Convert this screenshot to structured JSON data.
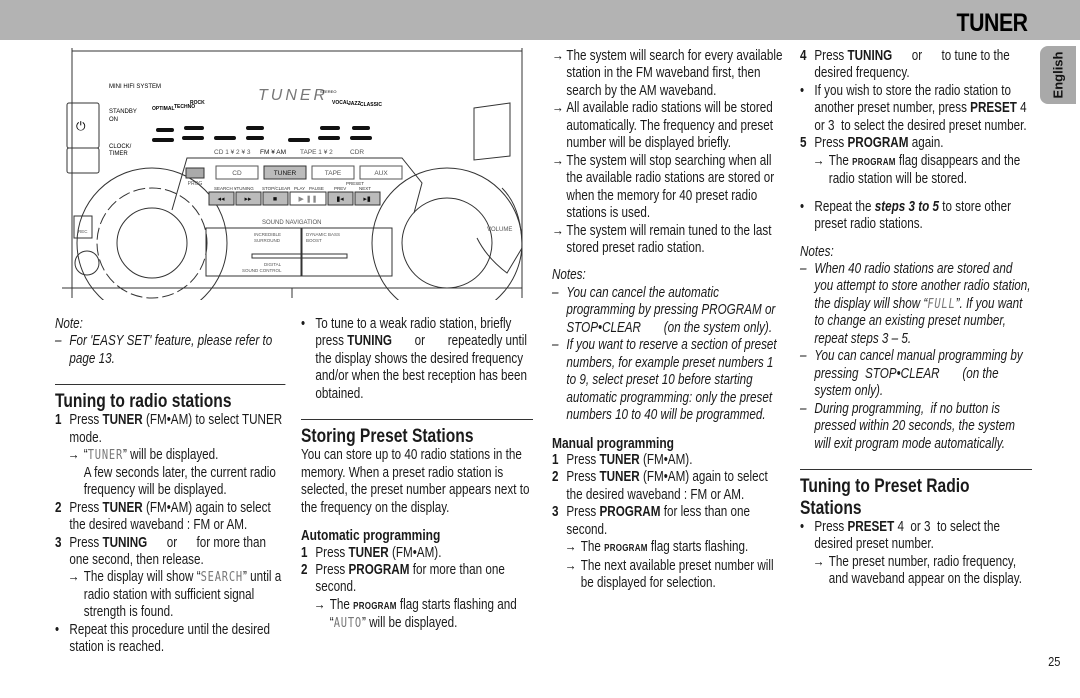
{
  "header": {
    "title": "TUNER",
    "language_tab": "English",
    "bar_color": "#b3b3b3"
  },
  "page_number": "25",
  "device": {
    "brand_label": "MINI HIFI SYSTEM",
    "display_text": "TUNER",
    "stereo_label": "STEREO",
    "standby_label": "STANDBY",
    "on_label": "ON",
    "clock_label": "CLOCK/",
    "timer_label": "TIMER",
    "source_labels": [
      "CD 1 ¥ 2 ¥ 3",
      "FM ¥ AM",
      "TAPE 1 ¥ 2",
      "CDR"
    ],
    "source_buttons": [
      "CD",
      "TUNER",
      "TAPE",
      "AUX"
    ],
    "prog_label": "PROG",
    "transport_labels": [
      "SEARCH ¥TUNING",
      "STOP/CLEAR",
      "PLAY",
      "PAUSE",
      "PREV",
      "PRESET",
      "NEXT"
    ],
    "sound_nav_label": "SOUND NAVIGATION",
    "incredible_label": "INCREDIBLE",
    "surround_label": "SURROUND",
    "dbb_label": "DYNAMIC BASS",
    "boost_label": "BOOST",
    "digital_label": "DIGITAL",
    "dsc_label": "SOUND CONTROL",
    "volume_label": "VOLUME",
    "rec_label": "REC",
    "eq_labels": [
      "OPTIMAL",
      "TECHNO",
      "ROCK",
      "VOCAL",
      "JAZZ",
      "CLASSIC"
    ]
  },
  "col1": {
    "items": [
      {
        "type": "notetitle",
        "segs": [
          {
            "t": "Note:"
          }
        ]
      },
      {
        "type": "dash",
        "mk": "–",
        "segs": [
          {
            "t": "For 'EASY SET' feature, please refer to page 13."
          }
        ]
      },
      {
        "type": "h2",
        "segs": [
          {
            "t": "Tuning to radio stations"
          }
        ]
      },
      {
        "type": "step",
        "mk": "1",
        "segs": [
          {
            "t": "Press "
          },
          {
            "b": "TUNER"
          },
          {
            "t": " (FM•AM) to select TUNER mode."
          }
        ]
      },
      {
        "type": "arrow",
        "mk": "→",
        "segs": [
          {
            "t": "“"
          },
          {
            "lcd": "TUNER"
          },
          {
            "t": "” will be displayed."
          }
        ]
      },
      {
        "type": "sub",
        "segs": [
          {
            "t": "A few seconds later, the current radio frequency will be displayed."
          }
        ]
      },
      {
        "type": "step",
        "mk": "2",
        "segs": [
          {
            "t": "Press "
          },
          {
            "b": "TUNER"
          },
          {
            "t": " (FM•AM) again to select the desired waveband : FM or AM."
          }
        ]
      },
      {
        "type": "step",
        "mk": "3",
        "segs": [
          {
            "t": "Press "
          },
          {
            "b": "TUNING"
          },
          {
            "t": "      or      for more than one second, then release."
          }
        ]
      },
      {
        "type": "arrow",
        "mk": "→",
        "segs": [
          {
            "t": "The display will show “"
          },
          {
            "lcd": "SEARCH"
          },
          {
            "t": "” until a radio station with sufficient signal strength is found."
          }
        ]
      },
      {
        "type": "bullet",
        "mk": "•",
        "segs": [
          {
            "t": "Repeat this procedure until the desired station is reached."
          }
        ]
      }
    ]
  },
  "col2": {
    "items": [
      {
        "type": "bullet",
        "mk": "•",
        "segs": [
          {
            "t": "To tune to a weak radio station, briefly press "
          },
          {
            "b": "TUNING"
          },
          {
            "t": "       or       repeatedly until the display shows the desired frequency and/or when the best reception has been obtained."
          }
        ]
      },
      {
        "type": "h2",
        "segs": [
          {
            "t": "Storing Preset Stations"
          }
        ]
      },
      {
        "type": "para",
        "segs": [
          {
            "t": "You can store up to 40 radio stations in the memory. When a preset radio station is selected, the preset number appears next to the frequency on the display."
          }
        ]
      },
      {
        "type": "h3",
        "segs": [
          {
            "t": "Automatic programming"
          }
        ]
      },
      {
        "type": "step",
        "mk": "1",
        "segs": [
          {
            "t": "Press "
          },
          {
            "b": "TUNER"
          },
          {
            "t": " (FM•AM)."
          }
        ]
      },
      {
        "type": "step",
        "mk": "2",
        "segs": [
          {
            "t": "Press "
          },
          {
            "b": "PROGRAM"
          },
          {
            "t": " for more than one second."
          }
        ]
      },
      {
        "type": "arrow",
        "mk": "→",
        "segs": [
          {
            "t": "The "
          },
          {
            "sc": "PROGRAM"
          },
          {
            "t": " flag starts flashing and “"
          },
          {
            "lcd": "AUTO"
          },
          {
            "t": "” will be displayed."
          }
        ]
      }
    ]
  },
  "col3": {
    "items": [
      {
        "type": "arrow top",
        "mk": "→",
        "segs": [
          {
            "t": "The system will search for every available station in the FM waveband first, then search by the AM waveband."
          }
        ]
      },
      {
        "type": "arrow top",
        "mk": "→",
        "segs": [
          {
            "t": "All available radio stations will be stored automatically. The frequency and preset number will be displayed briefly."
          }
        ]
      },
      {
        "type": "arrow top",
        "mk": "→",
        "segs": [
          {
            "t": "The system will stop searching when all the available radio stations are stored or when the memory for 40 preset radio stations is used."
          }
        ]
      },
      {
        "type": "arrow top",
        "mk": "→",
        "segs": [
          {
            "t": "The system will remain tuned to the last stored preset radio station."
          }
        ]
      },
      {
        "type": "gap"
      },
      {
        "type": "notetitle",
        "segs": [
          {
            "t": "Notes:"
          }
        ]
      },
      {
        "type": "dash",
        "mk": "–",
        "segs": [
          {
            "t": "You can cancel the automatic programming by pressing PROGRAM or STOP•CLEAR       (on the system only)."
          }
        ]
      },
      {
        "type": "dash",
        "mk": "–",
        "segs": [
          {
            "t": "If you want to reserve a section of preset numbers, for example preset numbers 1 to 9, select preset 10 before starting automatic programming: only the preset numbers 10 to 40 will be programmed."
          }
        ]
      },
      {
        "type": "h3",
        "segs": [
          {
            "t": "Manual programming"
          }
        ]
      },
      {
        "type": "step",
        "mk": "1",
        "segs": [
          {
            "t": "Press "
          },
          {
            "b": "TUNER"
          },
          {
            "t": " (FM•AM)."
          }
        ]
      },
      {
        "type": "step",
        "mk": "2",
        "segs": [
          {
            "t": "Press "
          },
          {
            "b": "TUNER"
          },
          {
            "t": " (FM•AM) again to select the desired waveband : FM or AM."
          }
        ]
      },
      {
        "type": "step",
        "mk": "3",
        "segs": [
          {
            "t": "Press "
          },
          {
            "b": "PROGRAM"
          },
          {
            "t": " for less than one second."
          }
        ]
      },
      {
        "type": "arrow",
        "mk": "→",
        "segs": [
          {
            "t": "The "
          },
          {
            "sc": "PROGRAM"
          },
          {
            "t": " flag starts flashing."
          }
        ]
      },
      {
        "type": "arrow",
        "mk": "→",
        "segs": [
          {
            "t": "The next available preset number will be displayed for selection."
          }
        ]
      }
    ]
  },
  "col4": {
    "items": [
      {
        "type": "step",
        "mk": "4",
        "segs": [
          {
            "t": "Press "
          },
          {
            "b": "TUNING"
          },
          {
            "t": "      or      to tune to the desired frequency."
          }
        ]
      },
      {
        "type": "bullet",
        "mk": "•",
        "segs": [
          {
            "t": "If you wish to store the radio station to another preset number, press "
          },
          {
            "b": "PRESET"
          },
          {
            "t": " 4  or 3  to select the desired preset number."
          }
        ]
      },
      {
        "type": "step",
        "mk": "5",
        "segs": [
          {
            "t": "Press "
          },
          {
            "b": "PROGRAM"
          },
          {
            "t": " again."
          }
        ]
      },
      {
        "type": "arrow",
        "mk": "→",
        "segs": [
          {
            "t": "The "
          },
          {
            "sc": "PROGRAM"
          },
          {
            "t": " flag disappears and the radio station will be stored."
          }
        ]
      },
      {
        "type": "gap"
      },
      {
        "type": "bullet",
        "mk": "•",
        "segs": [
          {
            "t": "Repeat the "
          },
          {
            "bi": "steps 3 to 5"
          },
          {
            "t": " to store other preset radio stations."
          }
        ]
      },
      {
        "type": "gap"
      },
      {
        "type": "notetitle",
        "segs": [
          {
            "t": "Notes:"
          }
        ]
      },
      {
        "type": "dash",
        "mk": "–",
        "segs": [
          {
            "t": "When 40 radio stations are stored and you attempt to store another radio station, the display will show “"
          },
          {
            "lcd": "FULL"
          },
          {
            "t": "”. If you want to change an existing preset number, repeat steps 3 – 5."
          }
        ]
      },
      {
        "type": "dash",
        "mk": "–",
        "segs": [
          {
            "t": "You can cancel manual programming by pressing  STOP•CLEAR       (on the system only)."
          }
        ]
      },
      {
        "type": "dash",
        "mk": "–",
        "segs": [
          {
            "t": "During programming,  if no button is pressed within 20 seconds, the system will exit program mode automatically."
          }
        ]
      },
      {
        "type": "h2",
        "segs": [
          {
            "t": "Tuning to Preset Radio Stations"
          }
        ]
      },
      {
        "type": "bullet",
        "mk": "•",
        "segs": [
          {
            "t": "Press "
          },
          {
            "b": "PRESET"
          },
          {
            "t": " 4  or 3  to select the desired preset number."
          }
        ]
      },
      {
        "type": "arrow",
        "mk": "→",
        "segs": [
          {
            "t": "The preset number, radio frequency, and waveband appear on the display."
          }
        ]
      }
    ]
  }
}
